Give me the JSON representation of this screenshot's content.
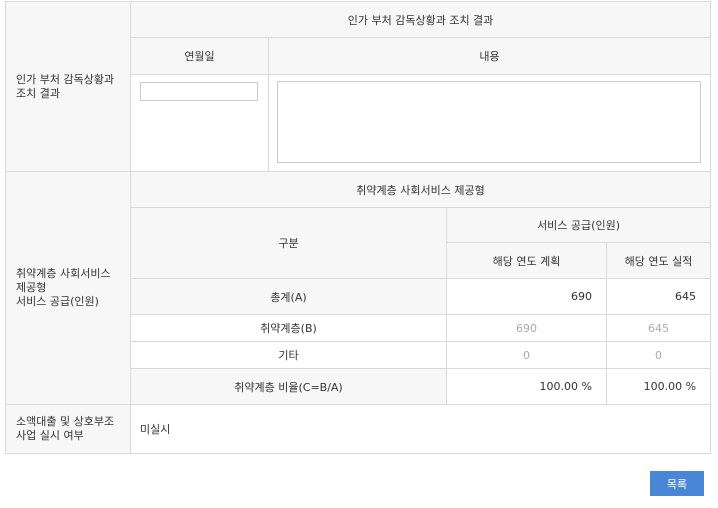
{
  "inspection": {
    "label": "인가 부처 감독상황과 조치 결과",
    "title": "인가 부처 감독상황과 조치 결과",
    "col_date": "연월일",
    "col_content": "내용",
    "date_value": "",
    "content_value": ""
  },
  "service": {
    "label_line1": "취약계층 사회서비스",
    "label_line2": "제공형",
    "label_line3": "서비스 공급(인원)",
    "title": "취약계층 사회서비스 제공형",
    "col_category": "구분",
    "col_supply": "서비스 공급(인원)",
    "col_plan": "해당 연도 계획",
    "col_actual": "해당 연도 실적",
    "rows": [
      {
        "name": "총계(A)",
        "plan": "690",
        "actual": "645"
      },
      {
        "name": "취약계층(B)",
        "plan": "690",
        "actual": "645"
      },
      {
        "name": "기타",
        "plan": "0",
        "actual": "0"
      },
      {
        "name": "취약계층 비율(C=B/A)",
        "plan": "100.00 %",
        "actual": "100.00 %"
      }
    ]
  },
  "loan": {
    "label_line1": "소액대출 및 상호부조",
    "label_line2": "사업 실시 여부",
    "value": "미실시"
  },
  "list_button": "목록"
}
